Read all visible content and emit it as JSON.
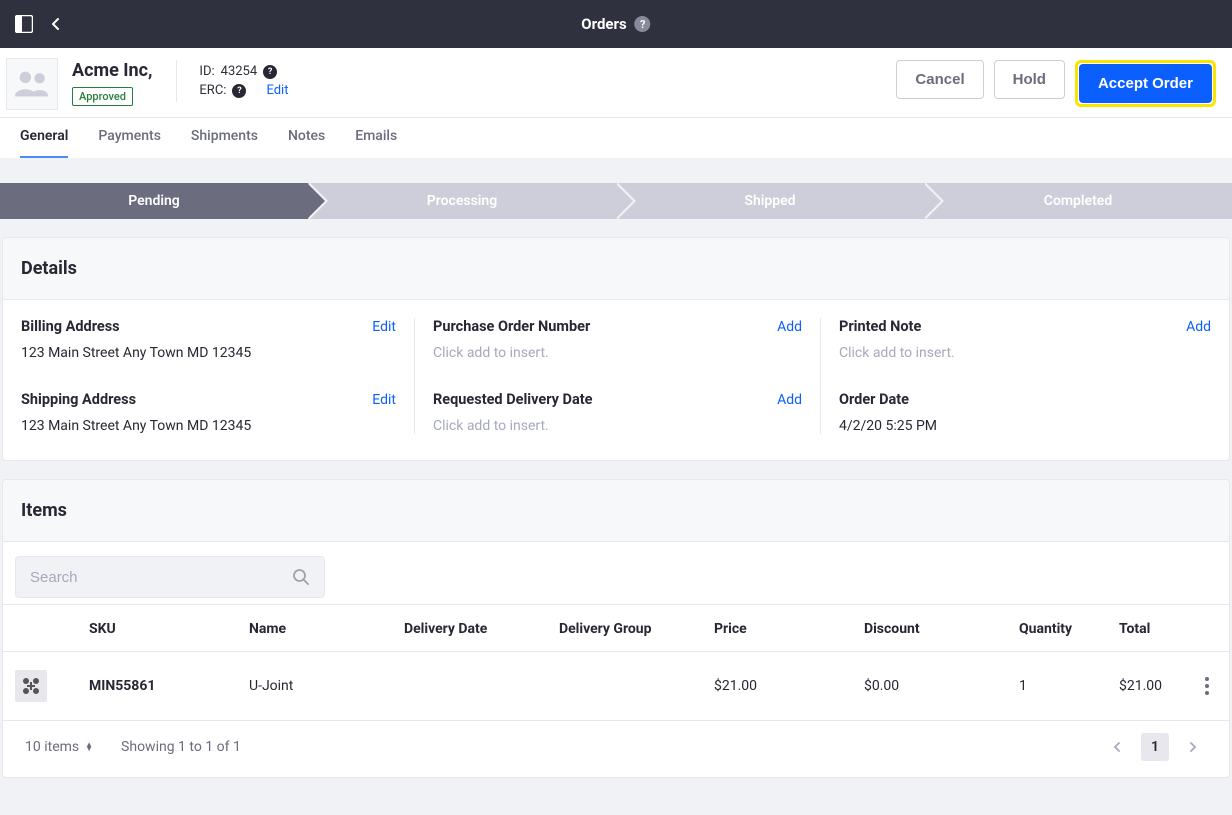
{
  "topbar": {
    "title": "Orders"
  },
  "customer": {
    "name": "Acme Inc,",
    "status": "Approved",
    "id_label": "ID:",
    "id_value": "43254",
    "erc_label": "ERC:",
    "edit": "Edit"
  },
  "actions": {
    "cancel": "Cancel",
    "hold": "Hold",
    "accept": "Accept Order"
  },
  "tabs": [
    "General",
    "Payments",
    "Shipments",
    "Notes",
    "Emails"
  ],
  "active_tab": 0,
  "progress": [
    "Pending",
    "Processing",
    "Shipped",
    "Completed"
  ],
  "details": {
    "header": "Details",
    "billing": {
      "label": "Billing Address",
      "action": "Edit",
      "value": "123 Main Street Any Town MD 12345"
    },
    "shipping": {
      "label": "Shipping Address",
      "action": "Edit",
      "value": "123 Main Street Any Town MD 12345"
    },
    "po": {
      "label": "Purchase Order Number",
      "action": "Add",
      "placeholder": "Click add to insert."
    },
    "rdd": {
      "label": "Requested Delivery Date",
      "action": "Add",
      "placeholder": "Click add to insert."
    },
    "note": {
      "label": "Printed Note",
      "action": "Add",
      "placeholder": "Click add to insert."
    },
    "order_date": {
      "label": "Order Date",
      "value": "4/2/20 5:25 PM"
    }
  },
  "items": {
    "header": "Items",
    "search_placeholder": "Search",
    "columns": [
      "SKU",
      "Name",
      "Delivery Date",
      "Delivery Group",
      "Price",
      "Discount",
      "Quantity",
      "Total"
    ],
    "rows": [
      {
        "sku": "MIN55861",
        "name": "U-Joint",
        "delivery_date": "",
        "delivery_group": "",
        "price": "$21.00",
        "discount": "$0.00",
        "quantity": "1",
        "total": "$21.00"
      }
    ],
    "page_size_label": "10 items",
    "showing": "Showing 1 to 1 of 1",
    "page": "1"
  }
}
